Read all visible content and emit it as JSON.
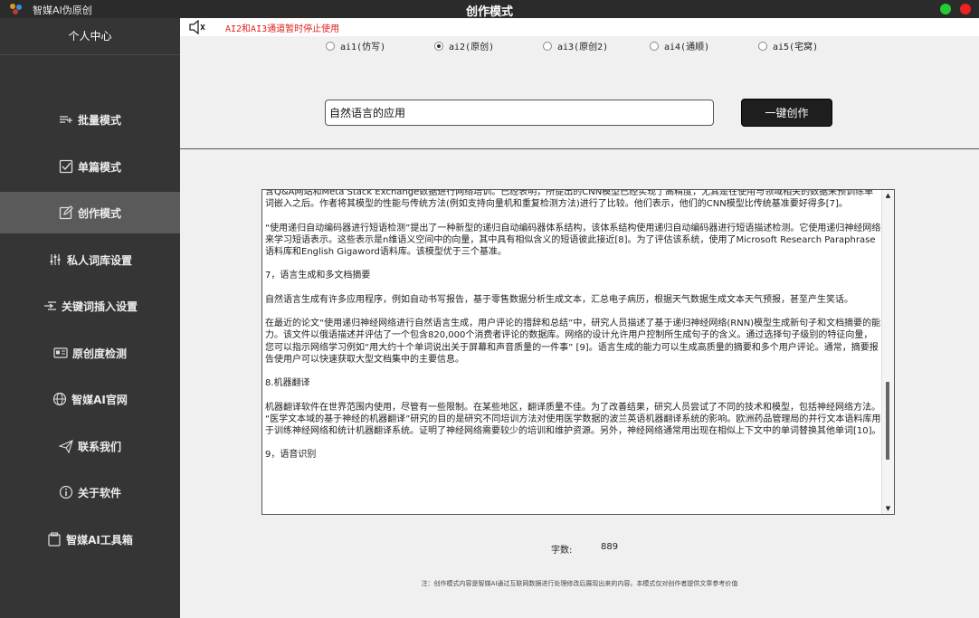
{
  "app": {
    "name": "智媒AI伪原创",
    "window_title": "创作模式"
  },
  "sidebar": {
    "header": "个人中心",
    "items": [
      {
        "label": "批量模式",
        "icon": "batch-list-icon"
      },
      {
        "label": "单篇模式",
        "icon": "checkbox-icon"
      },
      {
        "label": "创作模式",
        "icon": "edit-icon"
      },
      {
        "label": "私人词库设置",
        "icon": "sliders-icon"
      },
      {
        "label": "关键词插入设置",
        "icon": "insert-icon"
      },
      {
        "label": "原创度检测",
        "icon": "id-card-icon"
      },
      {
        "label": "智媒AI官网",
        "icon": "globe-icon"
      },
      {
        "label": "联系我们",
        "icon": "paper-plane-icon"
      },
      {
        "label": "关于软件",
        "icon": "info-icon"
      },
      {
        "label": "智媒AI工具箱",
        "icon": "toolbox-icon"
      }
    ]
  },
  "main": {
    "notice": "AI2和AI3通道暂时停止使用",
    "radios": [
      {
        "label": "ai1(仿写)",
        "checked": false
      },
      {
        "label": "ai2(原创)",
        "checked": true
      },
      {
        "label": "ai3(原创2)",
        "checked": false
      },
      {
        "label": "ai4(通顺)",
        "checked": false
      },
      {
        "label": "ai5(宅窝)",
        "checked": false
      }
    ],
    "topic_value": "自然语言的应用",
    "create_label": "一键创作",
    "article": [
      "含Q&A网站和Meta Stack Exchange数据进行网络培训。已经表明，所提出的CNN模型已经实现了高精度，尤其是在使用与领域相关的数据来预训练单词嵌入之后。作者将其模型的性能与传统方法(例如支持向量机和重复检测方法)进行了比较。他们表示，他们的CNN模型比传统基准要好得多[7]。",
      "“使用递归自动编码器进行短语检测”提出了一种新型的递归自动编码器体系结构，该体系结构使用递归自动编码器进行短语描述检测。它使用递归神经网络来学习短语表示。这些表示是n维语义空间中的向量，其中具有相似含义的短语彼此接近[8]。为了评估该系统，使用了Microsoft Research Paraphrase语料库和English Gigaword语料库。该模型优于三个基准。",
      "7，语言生成和多文档摘要",
      "自然语言生成有许多应用程序，例如自动书写报告，基于零售数据分析生成文本，汇总电子病历，根据天气数据生成文本天气预报，甚至产生笑话。",
      "在最近的论文“使用递归神经网络进行自然语言生成，用户评论的措辞和总结”中，研究人员描述了基于递归神经网络(RNN)模型生成新句子和文档摘要的能力。该文件以俄语描述并评估了一个包含820,000个消费者评论的数据库。网络的设计允许用户控制所生成句子的含义。通过选择句子级别的特征向量，您可以指示网络学习例如“用大约十个单词说出关于屏幕和声音质量的一件事” [9]。语言生成的能力可以生成高质量的摘要和多个用户评论。通常，摘要报告使用户可以快速获取大型文档集中的主要信息。",
      "8.机器翻译",
      "机器翻译软件在世界范围内使用，尽管有一些限制。在某些地区，翻译质量不佳。为了改善结果，研究人员尝试了不同的技术和模型，包括神经网络方法。 “医学文本域的基于神经的机器翻译”研究的目的是研究不同培训方法对使用医学数据的波兰英语机器翻译系统的影响。欧洲药品管理局的并行文本语料库用于训练神经网络和统计机器翻译系统。证明了神经网络需要较少的培训和维护资源。另外，神经网络通常用出现在相似上下文中的单词替换其他单词[10]。",
      "9，语音识别"
    ],
    "wordcount_label": "字数:",
    "wordcount_value": "889",
    "footer_note": "注：创作模式内容是智媒AI通过互联网数据进行处理修改后展现出来的内容。本模式仅对创作者提供文章参考价值"
  }
}
